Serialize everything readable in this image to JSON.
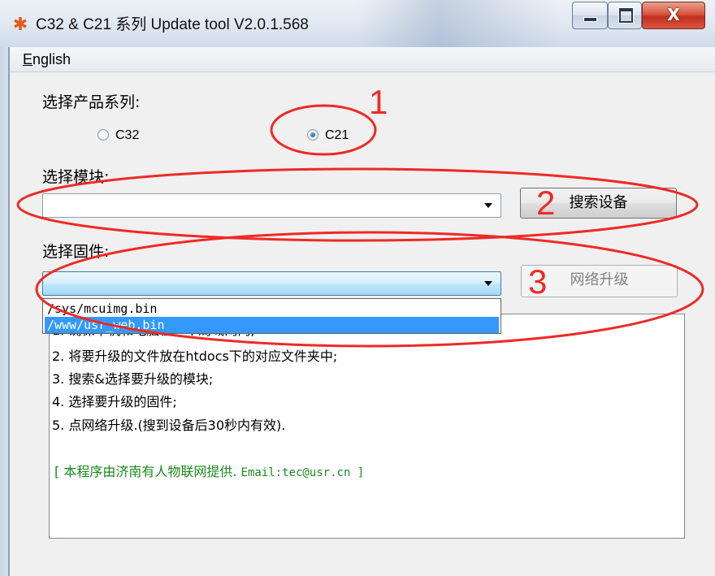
{
  "window": {
    "title": "C32 & C21 系列 Update tool V2.0.1.568",
    "icon": "app-logo-icon",
    "close_glyph": "X"
  },
  "menu": {
    "english_prefix": "E",
    "english_rest": "nglish"
  },
  "product": {
    "label": "选择产品系列:",
    "options": [
      {
        "label": "C32",
        "checked": false
      },
      {
        "label": "C21",
        "checked": true
      }
    ]
  },
  "module": {
    "label": "选择模块:",
    "value": "",
    "search_button": "搜索设备"
  },
  "firmware": {
    "label": "选择固件:",
    "value": "",
    "upgrade_button": "网络升级",
    "upgrade_enabled": false,
    "dropdown_options": [
      "/sys/mcuimg.bin",
      "/www/usr_web.bin"
    ],
    "selected_index": 1
  },
  "info": {
    "lines": [
      "1. 确保本机和电脑在一个局域网内;",
      "2. 将要升级的文件放在htdocs下的对应文件夹中;",
      "3. 搜索&选择要升级的模块;",
      "4. 选择要升级的固件;",
      "5. 点网络升级.(搜到设备后30秒内有效)."
    ],
    "credit_text": "[ 本程序由济南有人物联网提供.",
    "credit_email": "Email:tec@usr.cn ]"
  },
  "annotations": {
    "numbers": [
      "1",
      "2",
      "3"
    ],
    "color": "#ee2a24"
  },
  "colors": {
    "selection": "#3399ff",
    "credit": "#1a8a1a"
  }
}
